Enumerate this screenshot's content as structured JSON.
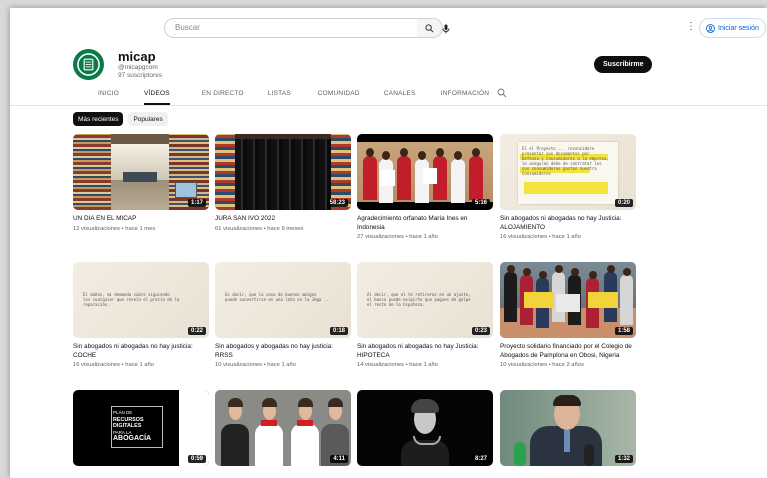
{
  "search": {
    "placeholder": "Buscar"
  },
  "header": {
    "signin_label": "Iniciar sesión"
  },
  "channel": {
    "name": "micap",
    "handle": "@micapgcom",
    "subscribers": "97 suscriptores",
    "subscribe_label": "Suscribirme"
  },
  "tabs": [
    "INICIO",
    "VÍDEOS",
    "EN DIRECTO",
    "LISTAS",
    "COMUNIDAD",
    "CANALES",
    "INFORMACIÓN"
  ],
  "active_tab": "VÍDEOS",
  "chips": [
    "Más recientes",
    "Populares"
  ],
  "videos": [
    {
      "title": "UN DIA EN EL MICAP",
      "meta": "12 visualizaciones • hace 1 mes",
      "duration": "1:17",
      "thumb": "library"
    },
    {
      "title": "JURA SAN IVO 2022",
      "meta": "61 visualizaciones • hace 9 meses",
      "duration": "58:23",
      "thumb": "robes"
    },
    {
      "title": "Agradecimiento orfanato María Ines en Indonesia",
      "meta": "27 visualizaciones • hace 1 año",
      "duration": "5:16",
      "thumb": "orphanage"
    },
    {
      "title": "Sin abogados ni abogadas no hay Justicia: ALOJAMIENTO",
      "meta": "16 visualizaciones • hace 1 año",
      "duration": "0:20",
      "thumb": "doc-yellow"
    },
    {
      "title": "Sin abogados ni abogadas no hay justicia: COCHE",
      "meta": "16 visualizaciones • hace 1 año",
      "duration": "0:22",
      "thumb": "doc"
    },
    {
      "title": "Sin abogados y abogadas no hay justicia: RRSS",
      "meta": "10 visualizaciones • hace 1 año",
      "duration": "0:18",
      "thumb": "doc"
    },
    {
      "title": "Sin abogados ni abogadas no hay Justicia: HIPOTECA",
      "meta": "14 visualizaciones • hace 1 año",
      "duration": "0:23",
      "thumb": "doc"
    },
    {
      "title": "Proyecto solidario financiado por el Colegio de Abogados de Pamplona en Obosi, Nigeria",
      "meta": "10 visualizaciones • hace 2 años",
      "duration": "1:58",
      "thumb": "nigeria"
    },
    {
      "title": "",
      "meta": "",
      "duration": "0:59",
      "thumb": "plan-digital"
    },
    {
      "title": "",
      "meta": "",
      "duration": "4:11",
      "thumb": "women"
    },
    {
      "title": "",
      "meta": "",
      "duration": "8:27",
      "thumb": "bw-woman"
    },
    {
      "title": "",
      "meta": "",
      "duration": "1:32",
      "thumb": "man-mics"
    }
  ],
  "thumb_text": {
    "plan_line1": "PLAN DE",
    "plan_line2": "RECURSOS DIGITALES",
    "plan_line3": "PARA LA",
    "plan_line4": "ABOGACÍA",
    "doc_alojamiento": "El el Proyecto ... reconsidere presentar sus documentos por\nDefensa y Consumidores a la empresa,\nle aseguran debe de contratar los\nsus consumidores gastos nuestra\nConsumidores",
    "doc_coche": "El daños, mi demanda cubre siguiendo\nlos cualquier que revela el precio de la\nreparación.",
    "doc_rrss": "Es decir, que la cosa de buenos amigos\npuede convertirse en una lata en la Jega ..",
    "doc_hipoteca": "Al decir, que el te retireras en un ajuste,\nel banco puede exigirte que pagues de golpe\nel resto de la hipoteca."
  },
  "colors": {
    "accent_blue": "#065fd4",
    "subscribe_bg": "#0f0f0f",
    "brand_green": "#0b7a4a"
  }
}
